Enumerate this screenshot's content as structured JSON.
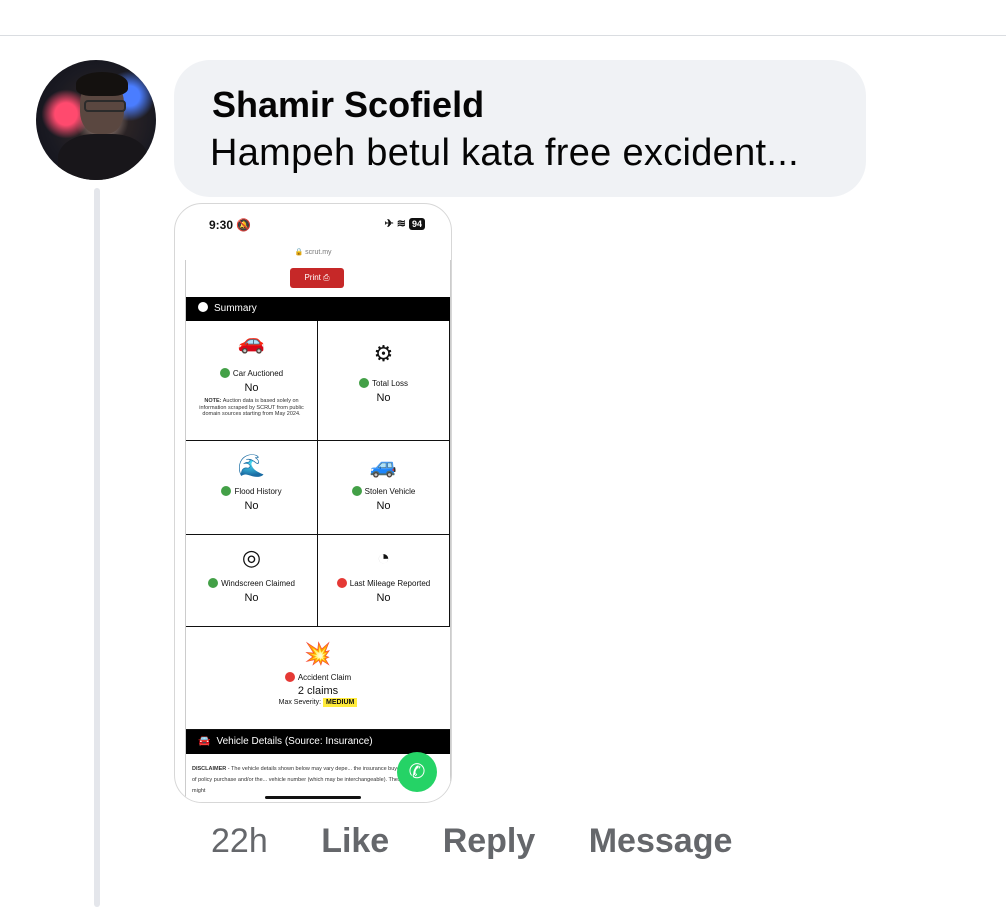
{
  "comment": {
    "author": "Shamir Scofield",
    "text": "Hampeh betul kata free excident...",
    "time": "22h",
    "actions": {
      "like": "Like",
      "reply": "Reply",
      "message": "Message"
    }
  },
  "screenshot": {
    "status_time": "9:30",
    "battery": "94",
    "url": "scrut.my",
    "print_label": "Print",
    "summary_title": "Summary",
    "note_label": "NOTE:",
    "note_text": "Auction data is based solely on information scraped by SCRUT from public domain sources starting from May 2024.",
    "cells": {
      "car_auctioned": {
        "label": "Car Auctioned",
        "value": "No",
        "icon": "sold-car-icon"
      },
      "total_loss": {
        "label": "Total Loss",
        "value": "No",
        "icon": "wrecked-car-icon"
      },
      "flood_history": {
        "label": "Flood History",
        "value": "No",
        "icon": "flood-icon"
      },
      "stolen_vehicle": {
        "label": "Stolen Vehicle",
        "value": "No",
        "icon": "thief-icon"
      },
      "windscreen_claimed": {
        "label": "Windscreen Claimed",
        "value": "No",
        "icon": "windscreen-icon"
      },
      "last_mileage": {
        "label": "Last Mileage Reported",
        "value": "No",
        "icon": "odometer-icon"
      },
      "accident_claim": {
        "label": "Accident Claim",
        "value": "2 claims",
        "severity_label": "Max Severity:",
        "severity": "MEDIUM",
        "icon": "crash-icon"
      }
    },
    "vehicle_details_title": "Vehicle Details (Source: Insurance)",
    "disclaimer_label": "DISCLAIMER",
    "disclaimer_text": " - The vehicle details shown below may vary depe... the insurance buyer at the time of policy purchase and/or the... vehicle number (which may be interchangeable). These details might"
  }
}
